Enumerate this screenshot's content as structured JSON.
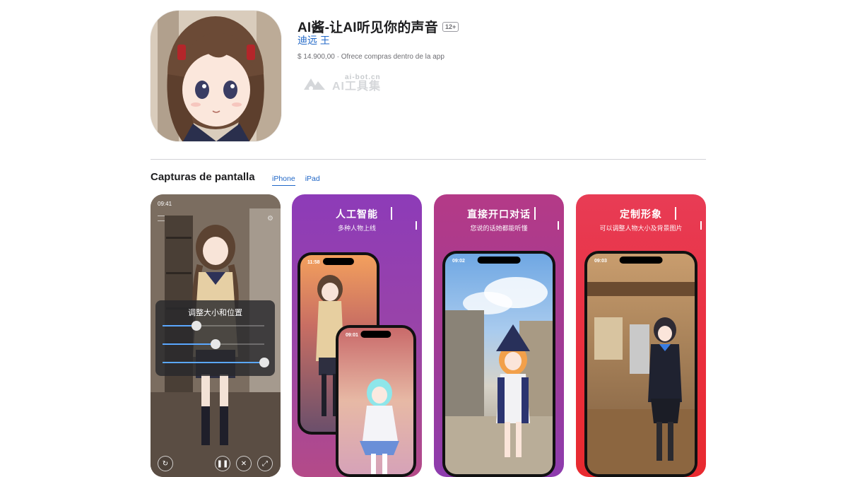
{
  "app": {
    "title": "AI酱-让AI听见你的声音",
    "age_rating": "12+",
    "developer": "迪远 王",
    "price_line": "$ 14.900,00 · Ofrece compras dentro de la app"
  },
  "watermark": {
    "url": "ai-bot.cn",
    "name": "AI工具集"
  },
  "screenshots_section": {
    "title": "Capturas de pantalla",
    "tabs": [
      {
        "label": "iPhone",
        "active": true
      },
      {
        "label": "iPad",
        "active": false
      }
    ]
  },
  "screenshots": [
    {
      "status_time": "09:41",
      "panel_title": "调整大小和位置",
      "sliders": [
        0.33,
        0.52,
        1.0
      ],
      "icons": [
        "menu-icon",
        "gear-icon",
        "rotate-icon",
        "pause-icon",
        "mute-icon",
        "resize-icon"
      ]
    },
    {
      "headline": "人工智能",
      "subline": "多种人物上线",
      "status_time_back": "11:58",
      "status_time_front": "09:01",
      "gradient": [
        "#8d3bb8",
        "#b44a88"
      ]
    },
    {
      "headline": "直接开口对话",
      "subline": "您说的话她都能听懂",
      "status_time": "09:02",
      "gradient": [
        "#b43a87",
        "#8d3cae"
      ]
    },
    {
      "headline": "定制形象",
      "subline": "可以调整人物大小及背景图片",
      "status_time": "09:03",
      "gradient": [
        "#e83c55",
        "#e82a2f"
      ]
    }
  ],
  "colors": {
    "link_blue": "#2067c7",
    "divider": "#d2d2d7"
  }
}
